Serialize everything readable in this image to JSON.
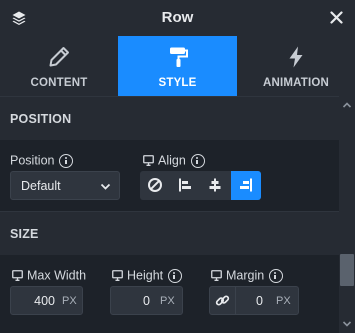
{
  "header": {
    "title": "Row",
    "layers_icon": "layers-icon",
    "close_icon": "close-icon"
  },
  "tabs": [
    {
      "label": "CONTENT",
      "icon": "pencil-icon",
      "active": false
    },
    {
      "label": "STYLE",
      "icon": "paint-roller-icon",
      "active": true
    },
    {
      "label": "ANIMATION",
      "icon": "lightning-icon",
      "active": false
    }
  ],
  "sections": {
    "position": {
      "title": "POSITION",
      "position_label": "Position",
      "position_value": "Default",
      "align_label": "Align",
      "align_options": [
        "none-icon",
        "align-left-icon",
        "align-center-icon",
        "align-right-icon"
      ],
      "align_selected": "align-right-icon"
    },
    "size": {
      "title": "SIZE",
      "max_width": {
        "label": "Max Width",
        "value": "400",
        "unit": "PX"
      },
      "height": {
        "label": "Height",
        "value": "0",
        "unit": "PX"
      },
      "margin": {
        "label": "Margin",
        "value": "0",
        "unit": "PX"
      }
    }
  },
  "colors": {
    "accent": "#1a8cff",
    "background": "#1d2229",
    "panel": "#262b33",
    "input": "#2f353e"
  }
}
